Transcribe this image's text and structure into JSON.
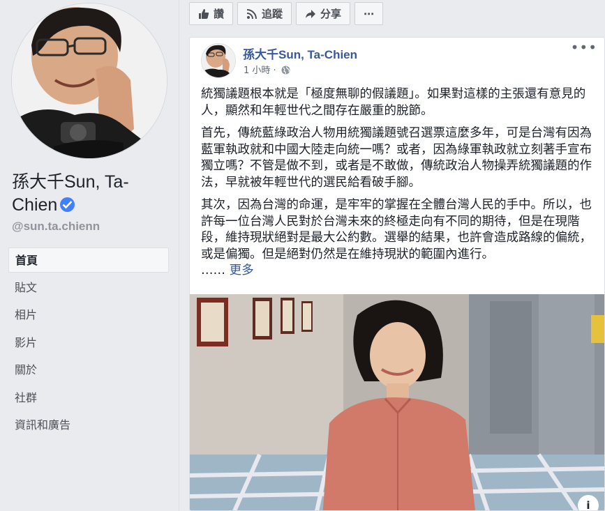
{
  "profile": {
    "name": "孫大千Sun, Ta-Chien",
    "handle": "@sun.ta.chienn"
  },
  "nav": {
    "items": [
      {
        "label": "首頁",
        "active": true
      },
      {
        "label": "貼文",
        "active": false
      },
      {
        "label": "相片",
        "active": false
      },
      {
        "label": "影片",
        "active": false
      },
      {
        "label": "關於",
        "active": false
      },
      {
        "label": "社群",
        "active": false
      },
      {
        "label": "資訊和廣告",
        "active": false
      }
    ]
  },
  "actions": {
    "like": "讚",
    "follow": "追蹤",
    "share": "分享",
    "more": "⋯"
  },
  "post": {
    "author": "孫大千Sun, Ta-Chien",
    "time": "1 小時 ·",
    "paragraphs": [
      "統獨議題根本就是「極度無聊的假議題」。如果對這樣的主張還有意見的人，顯然和年輕世代之間存在嚴重的脫節。",
      "首先，傳統藍綠政治人物用統獨議題號召選票這麼多年，可是台灣有因為藍軍執政就和中國大陸走向統一嗎？或者，因為綠軍執政就立刻著手宣布獨立嗎？不管是做不到，或者是不敢做，傳統政治人物操弄統獨議題的作法，早就被年輕世代的選民給看破手腳。",
      "其次，因為台灣的命運，是牢牢的掌握在全體台灣人民的手中。所以，也許每一位台灣人民對於台灣未來的終極走向有不同的期待，但是在現階段，維持現狀絕對是最大公約數。選舉的結果，也許會造成路線的偏統，或是偏獨。但是絕對仍然是在維持現狀的範圍內進行。"
    ],
    "ellipsis": "……",
    "see_more": "更多",
    "more_menu": "•••"
  },
  "colors": {
    "page_bg": "#e9ebee",
    "link": "#385898",
    "verified": "#4080ff"
  },
  "icons": [
    "like-icon",
    "follow-icon",
    "share-icon",
    "more-icon",
    "globe-icon",
    "verified-icon",
    "info-icon"
  ]
}
